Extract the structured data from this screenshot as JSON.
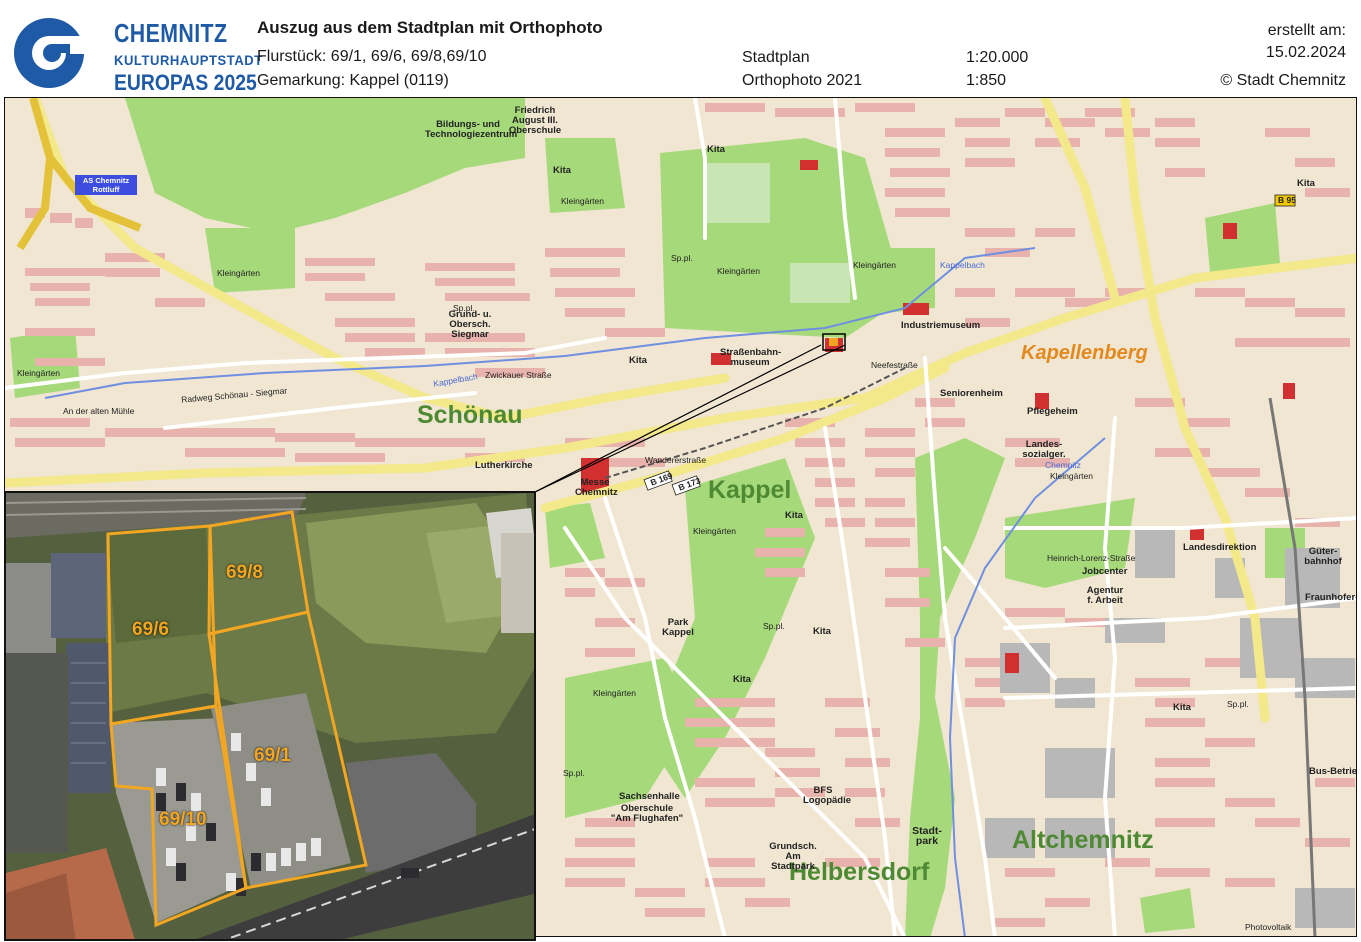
{
  "logo": {
    "line1": "CHEMNITZ",
    "line2": "KULTURHAUPTSTADT",
    "line3": "EUROPAS 2025",
    "brand_color": "#1f5aa6"
  },
  "header": {
    "title": "Auszug aus dem Stadtplan mit Orthophoto",
    "flurstueck": "Flurstück: 69/1, 69/6, 69/8,69/10",
    "gemarkung": "Gemarkung: Kappel (0119)",
    "stadtplan_label": "Stadtplan",
    "stadtplan_scale": "1:20.000",
    "ortho_label": "Orthophoto 2021",
    "ortho_scale": "1:850",
    "created_label": "erstellt am:",
    "created_date": "15.02.2024",
    "copyright": "© Stadt Chemnitz"
  },
  "map": {
    "colors": {
      "background": "#f0e6d2",
      "buildings": "#e8b3ac",
      "green": "#a6d97a",
      "roads_major": "#f3e88a",
      "water": "#6f8fe0",
      "highlight": "#f2a622"
    },
    "districts": [
      "Schönau",
      "Kappel",
      "Helbersdorf",
      "Altchemnitz"
    ],
    "district_orange": "Kapellenberg",
    "motorway_exit": "AS Chemnitz Rottluff",
    "road_badges": [
      "B 169",
      "B 173",
      "B 95"
    ],
    "labels": {
      "kleingaerten": "Kleingärten",
      "zwickauer": "Zwickauer Straße",
      "kappelbach": "Kappelbach",
      "radweg": "Radweg Schönau - Siegmar",
      "strassenbahnmuseum": "Straßenbahn-museum",
      "industriemuseum": "Industriemuseum",
      "park_kappel": "Park Kappel",
      "messe": "Messe Chemnitz",
      "bildungszentrum": "Bildungs- und Technologiezentrum",
      "oberschule": "Friedrich August III. Oberschule",
      "grundschule_siegmar": "Grund- u. Obersch. Siegmar",
      "lutherkirche": "Lutherkirche",
      "seniorenheim": "Seniorenheim",
      "pflegeheim": "Pflegeheim",
      "landessozialger": "Landes-sozialger.",
      "landesdirektion": "Landesdirektion",
      "jobcenter": "Jobcenter",
      "agentur": "Agentur f. Arbeit",
      "gueterbahnhof": "Güter-bahnhof",
      "fraunhofer": "Fraunhofer-Inst.",
      "bus_betriebshof": "Bus-Betriebsh.",
      "bfs": "BFS Logopädie",
      "grundsch_stadtpark": "Grundsch. Am Stadtpark",
      "stadtpark": "Stadt-park",
      "sachsenhalle": "Sachsenhalle",
      "obersch_flughafen": "Oberschule \"Am Flughafen\"",
      "an_der_alten_muehle": "An der alten Mühle",
      "kita": "Kita",
      "sp_pl": "Sp.pl.",
      "industriemuseum_short": "Industriemuseum",
      "wanderer": "Wandererstraße",
      "neefestrasse": "Neefestraße",
      "chemnitz_river": "Chemnitz",
      "photovoltaik": "Photovoltaik",
      "heinrich_lorenz": "Heinrich-Lorenz-Straße"
    }
  },
  "inset": {
    "parcels": [
      "69/8",
      "69/6",
      "69/1",
      "69/10"
    ],
    "outline_color": "#f2a622"
  }
}
